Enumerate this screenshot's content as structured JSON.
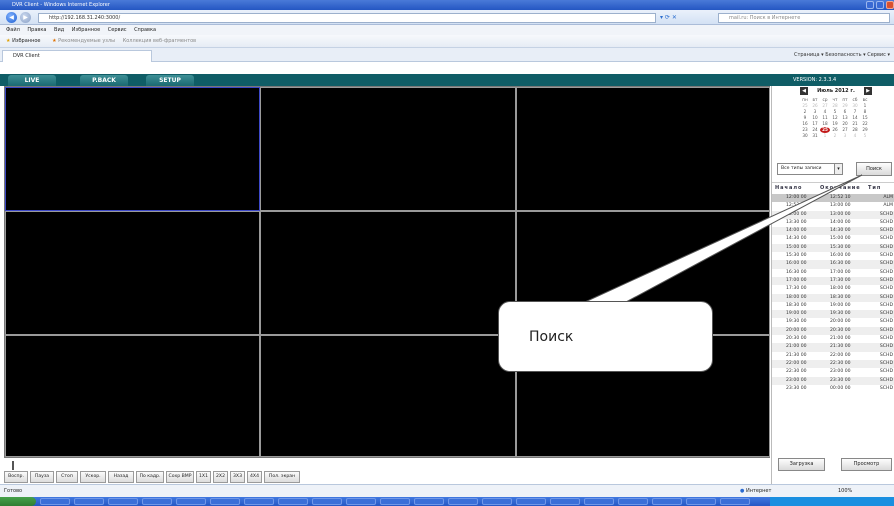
{
  "browser": {
    "title": "DVR Client - Windows Internet Explorer",
    "url": "http://192.168.31.240:3000/",
    "search_placeholder": "mail.ru: Поиск в Интернете",
    "menu": [
      "Файл",
      "Правка",
      "Вид",
      "Избранное",
      "Сервис",
      "Справка"
    ],
    "favorites_label": "Избранное",
    "fav_items": [
      "Рекомендуемые узлы",
      "Коллекция веб-фрагментов"
    ],
    "tab_title": "DVR Client",
    "tab_tools": "Страница ▾   Безопасность ▾   Сервис ▾"
  },
  "dvr": {
    "tabs": [
      "LIVE",
      "P.BACK",
      "SETUP"
    ],
    "version": "VERSION: 2.3.3.4",
    "calendar": {
      "month": "Июль 2012 г.",
      "weekdays": [
        "пн",
        "вт",
        "ср",
        "чт",
        "пт",
        "сб",
        "вс"
      ],
      "weeks": [
        [
          "25",
          "26",
          "27",
          "28",
          "29",
          "30",
          "1"
        ],
        [
          "2",
          "3",
          "4",
          "5",
          "6",
          "7",
          "8"
        ],
        [
          "9",
          "10",
          "11",
          "12",
          "13",
          "14",
          "15"
        ],
        [
          "16",
          "17",
          "18",
          "19",
          "20",
          "21",
          "22"
        ],
        [
          "23",
          "24",
          "25",
          "26",
          "27",
          "28",
          "29"
        ],
        [
          "30",
          "31",
          "1",
          "2",
          "3",
          "4",
          "5"
        ]
      ]
    },
    "record_type": "Все типы записи",
    "search_button": "Поиск",
    "results_headers": [
      "Начало",
      "Окончание",
      "Тип"
    ],
    "results": [
      [
        "12:00 00",
        "12:52 10",
        "ALM"
      ],
      [
        "12:52 27",
        "13:00 00",
        "ALM"
      ],
      [
        "13:00 00",
        "13:00 00",
        "SCHD"
      ],
      [
        "13:30 00",
        "14:00 00",
        "SCHD"
      ],
      [
        "14:00 00",
        "14:30 00",
        "SCHD"
      ],
      [
        "14:30 00",
        "15:00 00",
        "SCHD"
      ],
      [
        "15:00 00",
        "15:30 00",
        "SCHD"
      ],
      [
        "15:30 00",
        "16:00 00",
        "SCHD"
      ],
      [
        "16:00 00",
        "16:30 00",
        "SCHD"
      ],
      [
        "16:30 00",
        "17:00 00",
        "SCHD"
      ],
      [
        "17:00 00",
        "17:30 00",
        "SCHD"
      ],
      [
        "17:30 00",
        "18:00 00",
        "SCHD"
      ],
      [
        "18:00 00",
        "18:30 00",
        "SCHD"
      ],
      [
        "18:30 00",
        "19:00 00",
        "SCHD"
      ],
      [
        "19:00 00",
        "19:30 00",
        "SCHD"
      ],
      [
        "19:30 00",
        "20:00 00",
        "SCHD"
      ],
      [
        "20:00 00",
        "20:30 00",
        "SCHD"
      ],
      [
        "20:30 00",
        "21:00 00",
        "SCHD"
      ],
      [
        "21:00 00",
        "21:30 00",
        "SCHD"
      ],
      [
        "21:30 00",
        "22:00 00",
        "SCHD"
      ],
      [
        "22:00 00",
        "22:30 00",
        "SCHD"
      ],
      [
        "22:30 00",
        "23:00 00",
        "SCHD"
      ],
      [
        "23:00 00",
        "23:30 00",
        "SCHD"
      ],
      [
        "23:30 00",
        "00:00 00",
        "SCHD"
      ]
    ],
    "load_button": "Загрузка",
    "view_button": "Просмотр",
    "controls": [
      "Воспр.",
      "Пауза",
      "Стоп",
      "Ускор.",
      "Назад",
      "По кадр.",
      "Сохр ВМР",
      "1X1",
      "2X2",
      "3X3",
      "4X4",
      "Пол. экран"
    ]
  },
  "callout": "Поиск",
  "status": {
    "left": "Готово",
    "zone": "Интернет",
    "zoom": "100%"
  }
}
